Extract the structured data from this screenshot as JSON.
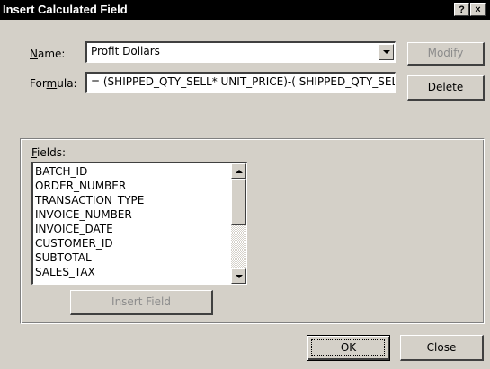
{
  "window": {
    "title": "Insert Calculated Field",
    "help_label": "?",
    "close_label": "×"
  },
  "name_label": {
    "pre": "",
    "key": "N",
    "post": "ame:"
  },
  "formula_label": {
    "pre": "For",
    "key": "m",
    "post": "ula:"
  },
  "name_value": "Profit Dollars",
  "formula_value": "= (SHIPPED_QTY_SELL* UNIT_PRICE)-( SHIPPED_QTY_SELL* COST)",
  "buttons": {
    "modify": "Modify",
    "delete": {
      "pre": "",
      "key": "D",
      "post": "elete"
    },
    "insert_field": "Insert Field",
    "ok": "OK",
    "close": "Close"
  },
  "fields_label": {
    "pre": "",
    "key": "F",
    "post": "ields:"
  },
  "fields": [
    "BATCH_ID",
    "ORDER_NUMBER",
    "TRANSACTION_TYPE",
    "INVOICE_NUMBER",
    "INVOICE_DATE",
    "CUSTOMER_ID",
    "SUBTOTAL",
    "SALES_TAX"
  ],
  "icons": {
    "combo_arrow": "chevron-down-icon",
    "scroll_up": "arrow-up-icon",
    "scroll_down": "arrow-down-icon"
  },
  "colors": {
    "face": "#d4d0c8",
    "titlebar": "#000000",
    "disabled_text": "#8c8c8c"
  }
}
